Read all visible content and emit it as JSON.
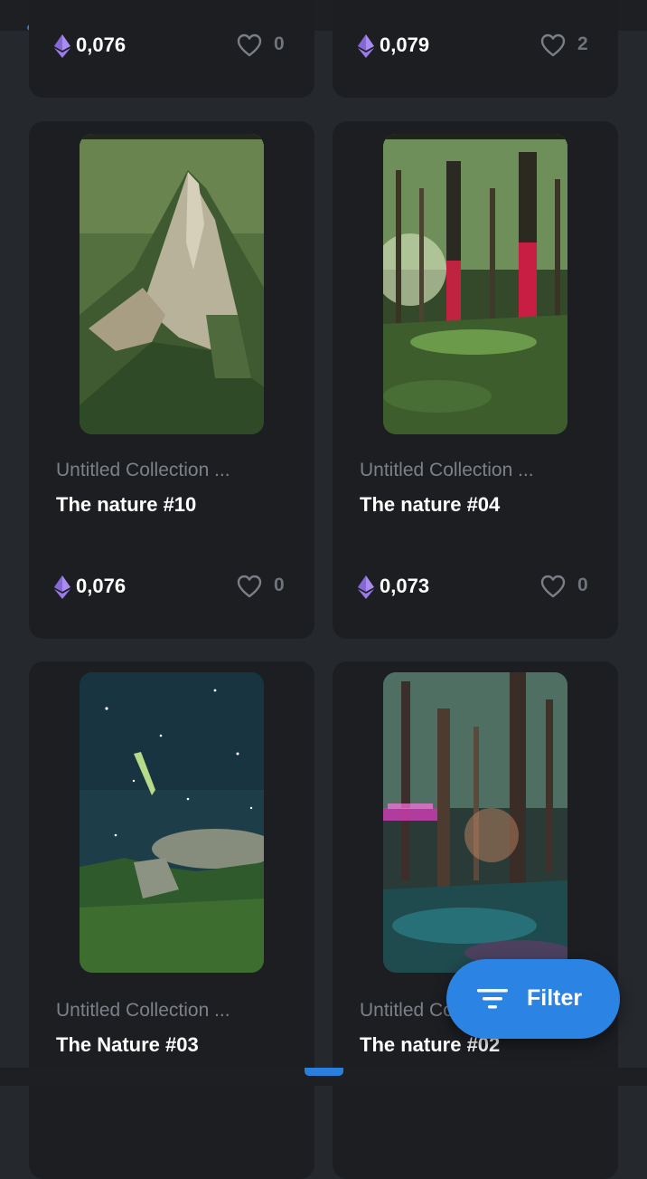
{
  "status": {
    "top_loading_progress": 0.27
  },
  "cards": [
    {
      "collection": "",
      "title": "",
      "price": "0,076",
      "likes": "0",
      "image": "",
      "price_icon": "ethereum-icon"
    },
    {
      "collection": "",
      "title": "",
      "price": "0,079",
      "likes": "2",
      "image": "",
      "price_icon": "ethereum-icon"
    },
    {
      "collection": "Untitled Collection ...",
      "title": "The nature #10",
      "price": "0,076",
      "likes": "0",
      "image": "mountain-painting",
      "price_icon": "ethereum-icon"
    },
    {
      "collection": "Untitled Collection ...",
      "title": "The nature #04",
      "price": "0,073",
      "likes": "0",
      "image": "forest-red-trees",
      "price_icon": "ethereum-icon"
    },
    {
      "collection": "Untitled Collection ...",
      "title": "The Nature #03",
      "price": "",
      "likes": "",
      "image": "night-sky-mountains",
      "price_icon": "ethereum-icon"
    },
    {
      "collection": "Untitled Collection ...",
      "title": "The nature #02",
      "price": "",
      "likes": "",
      "image": "neon-forest",
      "price_icon": "ethereum-icon"
    }
  ],
  "filter_button": {
    "label": "Filter",
    "icon": "filter-lines-icon"
  },
  "colors": {
    "background": "#25282d",
    "card": "#1c1e22",
    "accent": "#2b84e3",
    "eth_purple": "#9b7bea",
    "muted_text": "#7c8087"
  }
}
